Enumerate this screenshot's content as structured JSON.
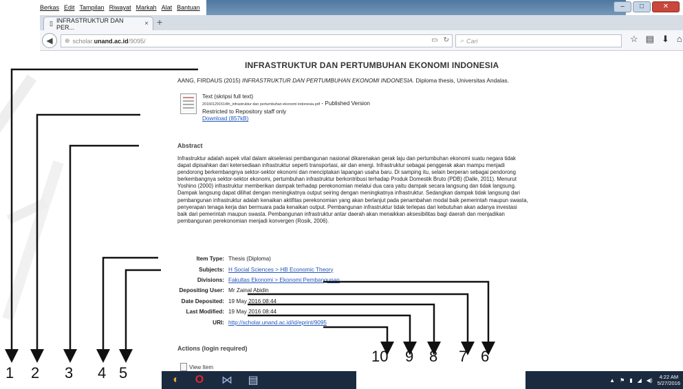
{
  "menu": [
    "Berkas",
    "Edit",
    "Tampilan",
    "Riwayat",
    "Markah",
    "Alat",
    "Bantuan"
  ],
  "browser": {
    "tab_title": "INFRASTRUKTUR DAN PER...",
    "tab_close": "×",
    "new_tab": "+",
    "url_prefix": "scholar.",
    "url_domain": "unand.ac.id",
    "url_path": "/9095/",
    "search_placeholder": "Cari"
  },
  "page": {
    "title": "INFRASTRUKTUR DAN PERTUMBUHAN EKONOMI INDONESIA",
    "citation_authors": "AANG, FIRDAUS (2015)",
    "citation_title": "INFRASTRUKTUR DAN PERTUMBUHAN EKONOMI INDONESIA.",
    "citation_tail": "Diploma thesis, Universitas Andalas.",
    "file": {
      "type_label": "Text (skripsi full text)",
      "filename": "201601291514th_infrastruktur dan pertumbuhan ekonomi indonesia.pdf",
      "version": "- Published Version",
      "restriction": "Restricted to Repository staff only",
      "download": "Download (857kB)"
    },
    "abstract_heading": "Abstract",
    "abstract": "Infrastruktur adalah aspek vital dalam akselerasi pembangunan nasional dikarenakan gerak laju dan pertumbuhan ekonomi suatu negara tidak dapat dipisahkan dari ketersediaan infrastruktur seperti transportasi, air dan energi. Infrastruktur sebagai penggerak akan mampu menjadi pendorong berkembangnya sektor-sektor ekonomi dan menciptakan lapangan usaha baru. Di samping itu, selain berperan sebagai pendorong berkembangnya sektor-sektor ekonomi, pertumbuhan infrastruktur berkontribusi terhadap Produk Domestik Bruto (PDB) (Dalle, 2011). Menurut Yoshino (2000) infrastruktur memberikan dampak terhadap perekonomian melalui dua cara yaitu dampak secara langsung dan tidak langsung. Dampak langsung dapat dilihat dengan meningkatnya output seiring dengan meningkatnya infrastruktur. Sedangkan dampak tidak langsung dari pembangunan infrastruktur adalah kenaikan aktifitas perekonomian yang akan berlanjut pada penambahan modal baik pemerintah maupun swasta, penyerapan tenaga kerja dan bermuara pada kenaikan output. Pembangunan infrastruktur tidak terlepas dari kebutuhan akan adanya investasi baik dari pemerintah maupun swasta. Pembangunan infrastruktur antar daerah akan menaikkan aksesibilitas bagi daerah dan menjadikan pembangunan perekonomian menjadi konvergen (Rosik, 2006).",
    "metadata": [
      {
        "key": "Item Type:",
        "value": "Thesis (Diploma)",
        "link": false
      },
      {
        "key": "Subjects:",
        "value": "H Social Sciences > HB Economic Theory",
        "link": true
      },
      {
        "key": "Divisions:",
        "value": "Fakultas Ekonomi > Ekonomi Pembangunan",
        "link": true
      },
      {
        "key": "Depositing User:",
        "value": "Mr Zainal Abidin",
        "link": false
      },
      {
        "key": "Date Deposited:",
        "value": "19 May 2016 08:44",
        "link": false
      },
      {
        "key": "Last Modified:",
        "value": "19 May 2016 08:44",
        "link": false
      },
      {
        "key": "URI:",
        "value": "http://scholar.unand.ac.id/id/eprint/9095",
        "link": true
      }
    ],
    "actions_heading": "Actions (login required)",
    "view_item": "View Item"
  },
  "taskbar": {
    "time": "4:22 AM",
    "date": "5/27/2016"
  },
  "annotations": {
    "labels": [
      "1",
      "2",
      "3",
      "4",
      "5",
      "10",
      "9",
      "8",
      "7",
      "6"
    ]
  },
  "colors": {
    "link": "#2255bb",
    "taskbar": "#1b2b3f",
    "titlebar": "#2f5f8f"
  }
}
